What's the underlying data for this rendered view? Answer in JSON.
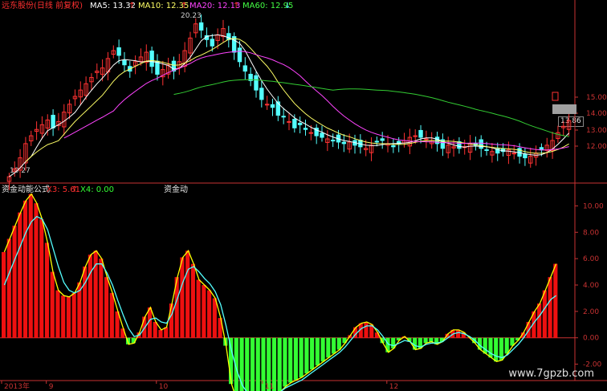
{
  "top_panel": {
    "title": "远东股份(日线 前复权)",
    "ma5": {
      "label": "MA5: 13.32",
      "arrow": "↑",
      "color": "#ffffff"
    },
    "ma10": {
      "label": "MA10: 12.35",
      "arrow": "↑",
      "color": "#ffff66"
    },
    "ma20": {
      "label": "MA20: 12.13",
      "arrow": "↑",
      "color": "#ff44ff"
    },
    "ma60": {
      "label": "MA60: 12.95",
      "arrow": "↓",
      "color": "#44ff44"
    },
    "high_annotation": "20.23",
    "low_annotation": "10.27",
    "last_price_tag": "13.86"
  },
  "bottom_panel": {
    "title": "资金动能公式",
    "x3": {
      "label": "X3: 5.61",
      "arrow": "↑"
    },
    "x4": {
      "label": "X4: 0.00"
    },
    "overlay_label": "资金动"
  },
  "x_axis_labels": [
    {
      "text": "2013年",
      "pos": 0.0
    },
    {
      "text": "9",
      "pos": 0.078
    },
    {
      "text": "10",
      "pos": 0.27
    },
    {
      "text": "11",
      "pos": 0.455
    },
    {
      "text": "12",
      "pos": 0.672
    }
  ],
  "watermark": "www.7gpzb.com",
  "colors": {
    "up": "#ff3232",
    "down": "#54ffff",
    "axis": "#c83232",
    "green_bar": "#33ff33",
    "red_bar": "#ee1010",
    "cyan_line": "#54ffff",
    "yellow_line": "#ffff00",
    "ma5_line": "#ffffff",
    "ma10_line": "#ffff66",
    "ma20_line": "#ff44ff",
    "ma60_line": "#33cc33"
  },
  "chart_data": [
    {
      "type": "candlestick",
      "title": "远东股份(日线 前复权)",
      "ylim": [
        10.0,
        15.5
      ],
      "y_ticks": [
        "12.00",
        "13.00",
        "14.00",
        "15.00"
      ],
      "series_close": [
        10.3,
        10.8,
        11.5,
        12.4,
        12.9,
        13.3,
        13.6,
        13.9,
        13.4,
        13.8,
        14.4,
        14.9,
        15.4,
        15.8,
        16.2,
        16.6,
        17.0,
        17.2,
        17.8,
        18.3,
        18.0,
        17.4,
        17.0,
        17.6,
        17.9,
        18.2,
        17.3,
        16.8,
        17.1,
        17.4,
        17.0,
        17.6,
        18.3,
        19.1,
        20.0,
        19.6,
        19.0,
        18.6,
        19.3,
        19.7,
        19.0,
        18.2,
        17.6,
        17.0,
        16.4,
        15.8,
        15.2,
        14.9,
        14.7,
        14.2,
        14.1,
        13.8,
        13.4,
        13.6,
        13.3,
        13.1,
        12.9,
        12.8,
        12.7,
        12.6,
        12.5,
        12.4,
        12.5,
        12.3,
        12.2,
        12.1,
        12.3,
        12.5,
        12.6,
        12.4,
        12.2,
        12.4,
        12.6,
        12.8,
        12.9,
        12.8,
        12.7,
        12.6,
        12.4,
        12.1,
        12.3,
        12.2,
        12.1,
        12.2,
        12.4,
        12.3,
        12.1,
        12.0,
        11.9,
        11.8,
        11.9,
        12.0,
        11.8,
        11.6,
        11.5,
        11.6,
        11.8,
        12.0,
        12.3,
        12.6,
        13.1,
        13.5,
        13.86
      ],
      "ma5_color": "#ffffff",
      "ma10_color": "#ffff66",
      "ma20_color": "#ff44ff",
      "ma60_color": "#33cc33"
    },
    {
      "type": "bar",
      "title": "资金动能公式",
      "ylim": [
        -3.0,
        11.0
      ],
      "y_ticks": [
        "-2.00",
        "0.00",
        "2.00",
        "4.00",
        "6.00",
        "8.00",
        "10.00"
      ],
      "values": [
        6.5,
        7.5,
        8.5,
        9.5,
        10.4,
        10.9,
        10.2,
        9.0,
        7.2,
        5.0,
        3.6,
        3.2,
        3.1,
        3.4,
        4.2,
        5.4,
        6.3,
        6.6,
        6.0,
        4.6,
        3.4,
        2.0,
        0.7,
        -0.5,
        -0.4,
        0.4,
        1.6,
        2.3,
        1.2,
        0.6,
        0.8,
        2.6,
        4.6,
        6.1,
        6.6,
        5.6,
        4.4,
        4.0,
        3.6,
        3.0,
        1.5,
        -0.6,
        -3.5,
        -4.8,
        -5.2,
        -5.4,
        -5.3,
        -5.1,
        -4.9,
        -4.6,
        -4.3,
        -4.1,
        -3.7,
        -3.4,
        -3.2,
        -3.0,
        -2.7,
        -2.4,
        -2.1,
        -1.8,
        -1.5,
        -1.2,
        -0.9,
        -0.4,
        0.2,
        0.8,
        1.1,
        1.2,
        1.0,
        0.4,
        -0.4,
        -1.1,
        -0.8,
        -0.2,
        0.1,
        -0.3,
        -0.9,
        -0.8,
        -0.4,
        -0.3,
        -0.5,
        -0.3,
        0.3,
        0.6,
        0.6,
        0.4,
        0.0,
        -0.4,
        -0.9,
        -1.2,
        -1.5,
        -1.8,
        -1.7,
        -1.2,
        -0.6,
        -0.2,
        0.4,
        1.2,
        2.0,
        2.6,
        3.6,
        4.6,
        5.61
      ],
      "signal_line": [
        4.0,
        5.0,
        6.0,
        7.0,
        8.0,
        8.8,
        9.2,
        9.0,
        8.2,
        6.8,
        5.4,
        4.2,
        3.6,
        3.4,
        3.6,
        4.2,
        5.0,
        5.6,
        5.6,
        4.9,
        4.0,
        2.8,
        1.7,
        0.7,
        0.1,
        0.2,
        0.8,
        1.4,
        1.5,
        1.2,
        1.1,
        1.8,
        3.0,
        4.2,
        5.2,
        5.4,
        5.0,
        4.5,
        4.1,
        3.5,
        2.5,
        0.9,
        -1.0,
        -2.5,
        -3.6,
        -4.2,
        -4.5,
        -4.7,
        -4.7,
        -4.5,
        -4.3,
        -4.1,
        -3.8,
        -3.6,
        -3.4,
        -3.2,
        -2.9,
        -2.6,
        -2.3,
        -2.0,
        -1.7,
        -1.4,
        -1.1,
        -0.7,
        -0.2,
        0.3,
        0.7,
        0.9,
        0.9,
        0.6,
        0.1,
        -0.5,
        -0.6,
        -0.4,
        -0.2,
        -0.3,
        -0.6,
        -0.7,
        -0.5,
        -0.4,
        -0.4,
        -0.3,
        0.0,
        0.3,
        0.4,
        0.3,
        0.1,
        -0.2,
        -0.6,
        -0.9,
        -1.2,
        -1.4,
        -1.5,
        -1.3,
        -0.9,
        -0.5,
        0.0,
        0.6,
        1.2,
        1.7,
        2.3,
        2.9,
        3.2
      ]
    }
  ]
}
